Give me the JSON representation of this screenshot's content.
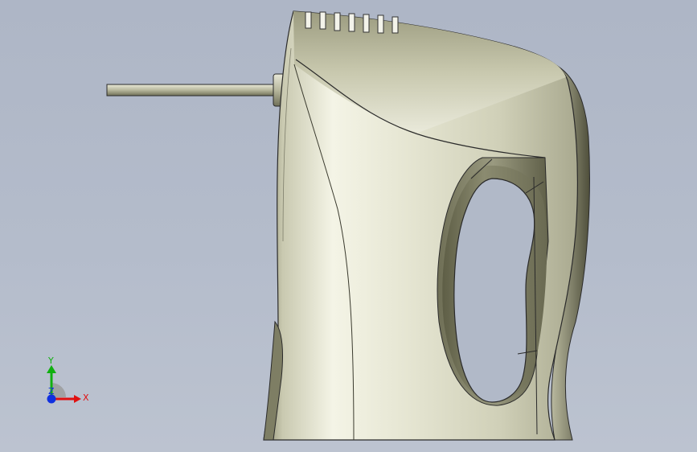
{
  "viewport": {
    "background_top": "#aeb6c6",
    "background_bottom": "#bcc3d0"
  },
  "model": {
    "icon": "hand-mixer-3d-model",
    "shell_color": "#d6d6bf",
    "edge_color": "#2a2a2a"
  },
  "triad": {
    "x_label": "X",
    "y_label": "Y",
    "z_label": "Z",
    "x_color": "#e01010",
    "y_color": "#10b010",
    "z_color": "#1030e0"
  }
}
